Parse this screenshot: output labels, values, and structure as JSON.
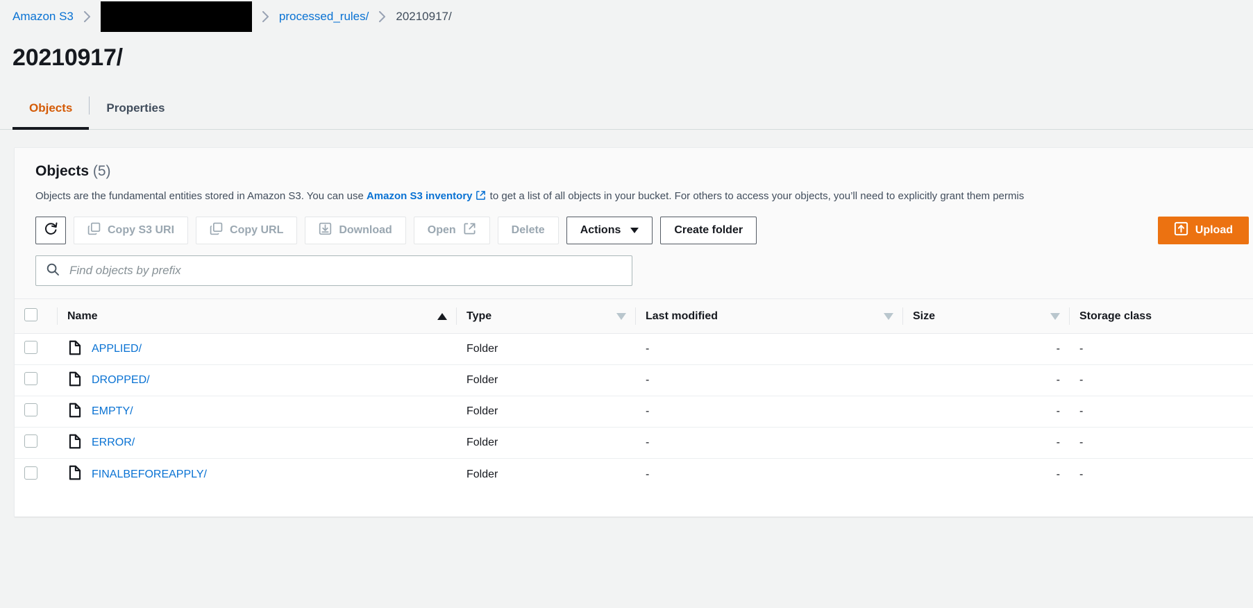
{
  "breadcrumb": {
    "items": [
      {
        "label": "Amazon S3",
        "type": "link",
        "name": "breadcrumb-amazon-s3"
      },
      {
        "label": "",
        "type": "redacted",
        "name": "breadcrumb-bucket-redacted"
      },
      {
        "label": "processed_rules/",
        "type": "link",
        "name": "breadcrumb-processed-rules"
      },
      {
        "label": "20210917/",
        "type": "current",
        "name": "breadcrumb-current"
      }
    ]
  },
  "page": {
    "title": "20210917/"
  },
  "tabs": [
    {
      "label": "Objects",
      "active": true
    },
    {
      "label": "Properties",
      "active": false
    }
  ],
  "panel": {
    "title": "Objects",
    "count": "(5)",
    "description_before": "Objects are the fundamental entities stored in Amazon S3. You can use ",
    "description_link": "Amazon S3 inventory",
    "description_after": " to get a list of all objects in your bucket. For others to access your objects, you’ll need to explicitly grant them permis"
  },
  "toolbar": {
    "refresh_label": "",
    "copy_s3_uri_label": "Copy S3 URI",
    "copy_url_label": "Copy URL",
    "download_label": "Download",
    "open_label": "Open",
    "delete_label": "Delete",
    "actions_label": "Actions",
    "create_folder_label": "Create folder",
    "upload_label": "Upload"
  },
  "search": {
    "placeholder": "Find objects by prefix",
    "value": ""
  },
  "table": {
    "columns": [
      {
        "label": "Name",
        "sort": "asc"
      },
      {
        "label": "Type",
        "sort": "idle"
      },
      {
        "label": "Last modified",
        "sort": "idle"
      },
      {
        "label": "Size",
        "sort": "idle"
      },
      {
        "label": "Storage class",
        "sort": "none"
      }
    ],
    "rows": [
      {
        "name": "APPLIED/",
        "type": "Folder",
        "last_modified": "-",
        "size": "-",
        "storage_class": "-"
      },
      {
        "name": "DROPPED/",
        "type": "Folder",
        "last_modified": "-",
        "size": "-",
        "storage_class": "-"
      },
      {
        "name": "EMPTY/",
        "type": "Folder",
        "last_modified": "-",
        "size": "-",
        "storage_class": "-"
      },
      {
        "name": "ERROR/",
        "type": "Folder",
        "last_modified": "-",
        "size": "-",
        "storage_class": "-"
      },
      {
        "name": "FINALBEFOREAPPLY/",
        "type": "Folder",
        "last_modified": "-",
        "size": "-",
        "storage_class": "-"
      }
    ]
  },
  "colors": {
    "accent_orange": "#ec7211",
    "active_tab": "#d45b07",
    "link_blue": "#0972d3",
    "page_bg": "#f2f3f3",
    "text_dark": "#16191f",
    "text_muted": "#5f6b7a",
    "disabled": "#9aa7b1"
  }
}
